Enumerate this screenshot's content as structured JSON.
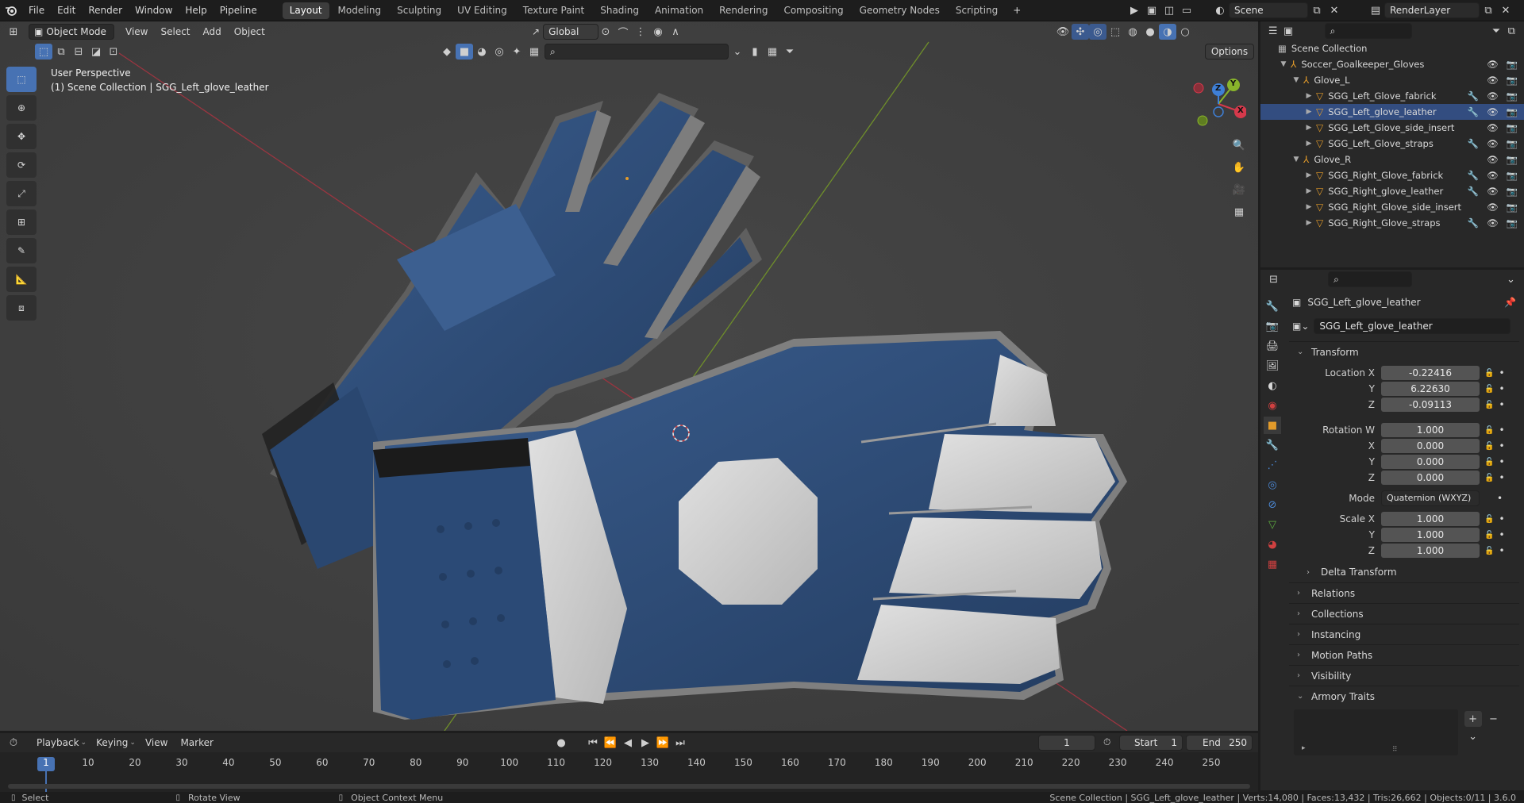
{
  "topbar": {
    "menus": [
      "File",
      "Edit",
      "Render",
      "Window",
      "Help",
      "Pipeline"
    ],
    "workspaces": [
      "Layout",
      "Modeling",
      "Sculpting",
      "UV Editing",
      "Texture Paint",
      "Shading",
      "Animation",
      "Rendering",
      "Compositing",
      "Geometry Nodes",
      "Scripting"
    ],
    "active_workspace": "Layout",
    "add_workspace": "+",
    "scene_name": "Scene",
    "view_layer": "RenderLayer"
  },
  "viewport": {
    "mode": "Object Mode",
    "menus": [
      "View",
      "Select",
      "Add",
      "Object"
    ],
    "transform_orientation": "Global",
    "options_label": "Options",
    "overlay_title": "User Perspective",
    "overlay_subtitle": "(1) Scene Collection | SGG_Left_glove_leather",
    "gizmo_axes": {
      "x": "X",
      "y": "Y",
      "z": "Z"
    }
  },
  "outliner": {
    "root": "Scene Collection",
    "items": [
      {
        "label": "Soccer_Goalkeeper_Gloves",
        "depth": 1,
        "kind": "empty",
        "expanded": true
      },
      {
        "label": "Glove_L",
        "depth": 2,
        "kind": "empty",
        "expanded": true
      },
      {
        "label": "SGG_Left_Glove_fabrick",
        "depth": 3,
        "kind": "mesh",
        "modifier": true
      },
      {
        "label": "SGG_Left_glove_leather",
        "depth": 3,
        "kind": "mesh",
        "modifier": true,
        "selected": true
      },
      {
        "label": "SGG_Left_Glove_side_insert",
        "depth": 3,
        "kind": "mesh",
        "modifier": false
      },
      {
        "label": "SGG_Left_Glove_straps",
        "depth": 3,
        "kind": "mesh",
        "modifier": true
      },
      {
        "label": "Glove_R",
        "depth": 2,
        "kind": "empty",
        "expanded": true
      },
      {
        "label": "SGG_Right_Glove_fabrick",
        "depth": 3,
        "kind": "mesh",
        "modifier": true
      },
      {
        "label": "SGG_Right_glove_leather",
        "depth": 3,
        "kind": "mesh",
        "modifier": true
      },
      {
        "label": "SGG_Right_Glove_side_insert",
        "depth": 3,
        "kind": "mesh",
        "modifier": false
      },
      {
        "label": "SGG_Right_Glove_straps",
        "depth": 3,
        "kind": "mesh",
        "modifier": true
      }
    ]
  },
  "properties": {
    "object_name": "SGG_Left_glove_leather",
    "datablock_name": "SGG_Left_glove_leather",
    "transform_label": "Transform",
    "location": {
      "label": "Location X",
      "x": "-0.22416",
      "y": "6.22630",
      "z": "-0.09113"
    },
    "rotation": {
      "label": "Rotation W",
      "w": "1.000",
      "x": "0.000",
      "y": "0.000",
      "z": "0.000"
    },
    "axis_labels": {
      "x": "X",
      "y": "Y",
      "z": "Z"
    },
    "mode_label": "Mode",
    "mode_value": "Quaternion (WXYZ)",
    "scale": {
      "label": "Scale X",
      "x": "1.000",
      "y": "1.000",
      "z": "1.000"
    },
    "delta_transform": "Delta Transform",
    "panels": [
      "Relations",
      "Collections",
      "Instancing",
      "Motion Paths",
      "Visibility"
    ],
    "armory_traits": "Armory Traits",
    "add_symbol": "+",
    "remove_symbol": "−"
  },
  "timeline": {
    "menus": [
      "Playback",
      "Keying",
      "View",
      "Marker"
    ],
    "current_frame": "1",
    "start_label": "Start",
    "start_value": "1",
    "end_label": "End",
    "end_value": "250",
    "ticks": [
      "1",
      "10",
      "20",
      "30",
      "40",
      "50",
      "60",
      "70",
      "80",
      "90",
      "100",
      "110",
      "120",
      "130",
      "140",
      "150",
      "160",
      "170",
      "180",
      "190",
      "200",
      "210",
      "220",
      "230",
      "240",
      "250"
    ]
  },
  "statusbar": {
    "select": "Select",
    "rotate": "Rotate View",
    "context": "Object Context Menu",
    "stats": "Scene Collection | SGG_Left_glove_leather | Verts:14,080 | Faces:13,432 | Tris:26,662 | Objects:0/11 | 3.6.0"
  },
  "colors": {
    "accent": "#4772b3",
    "selected_row": "#334d80",
    "viewport_bg": "#3d3d3d",
    "glove_blue": "#2f4d78",
    "glove_grey": "#c9c9c9",
    "x_axis": "#d6394b",
    "y_axis": "#89b52b",
    "z_axis": "#3e7fd6"
  }
}
